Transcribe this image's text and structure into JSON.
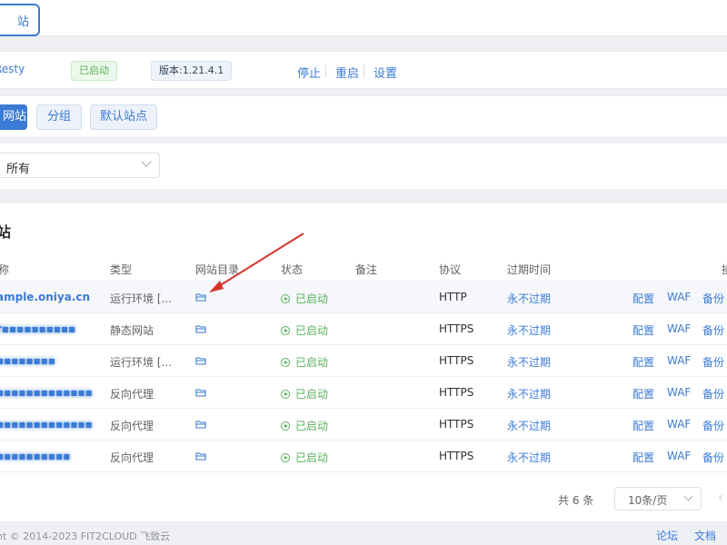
{
  "top_tab": {
    "label": "站"
  },
  "status_bar": {
    "app_name": "Resty",
    "running_tag": "已启动",
    "version_tag": "版本:1.21.4.1",
    "actions": [
      "停止",
      "重启",
      "设置"
    ]
  },
  "toolbar": {
    "primary_label": "网站",
    "group_label": "分组",
    "default_site_label": "默认站点"
  },
  "filter": {
    "selected": "所有"
  },
  "table": {
    "title": "站",
    "headers": [
      "称",
      "类型",
      "网站目录",
      "状态",
      "备注",
      "协议",
      "过期时间",
      "操"
    ],
    "rows": [
      {
        "site": "ample.oniya.cn",
        "type": "运行环境 [...",
        "status": "已启动",
        "protocol": "HTTP",
        "expiry": "永不过期",
        "ops": [
          "配置",
          "WAF",
          "备份"
        ]
      },
      {
        "site": "r▪▪▪▪▪▪▪▪▪▪",
        "type": "静态网站",
        "status": "已启动",
        "protocol": "HTTPS",
        "expiry": "永不过期",
        "ops": [
          "配置",
          "WAF",
          "备份"
        ]
      },
      {
        "site": "▪▪▪▪▪▪▪▪",
        "type": "运行环境 [...",
        "status": "已启动",
        "protocol": "HTTPS",
        "expiry": "永不过期",
        "ops": [
          "配置",
          "WAF",
          "备份"
        ]
      },
      {
        "site": "▪▪▪▪▪▪▪▪▪▪▪▪▪",
        "type": "反向代理",
        "status": "已启动",
        "protocol": "HTTPS",
        "expiry": "永不过期",
        "ops": [
          "配置",
          "WAF",
          "备份"
        ]
      },
      {
        "site": "▪▪▪▪▪▪▪▪▪▪▪▪▪",
        "type": "反向代理",
        "status": "已启动",
        "protocol": "HTTPS",
        "expiry": "永不过期",
        "ops": [
          "配置",
          "WAF",
          "备份"
        ]
      },
      {
        "site": "▪▪▪▪▪▪▪▪▪▪",
        "type": "反向代理",
        "status": "已启动",
        "protocol": "HTTPS",
        "expiry": "永不过期",
        "ops": [
          "配置",
          "WAF",
          "备份"
        ]
      }
    ]
  },
  "pagination": {
    "total": "共 6 条",
    "page_size": "10条/页"
  },
  "footer": {
    "copyright": "nt © 2014-2023 FIT2CLOUD 飞致云",
    "links": [
      "论坛",
      "文档"
    ]
  },
  "colors": {
    "accent": "#3a7bd5",
    "success": "#5ab25a",
    "annotation": "#d9342b"
  },
  "icons": {
    "folder": "folder-icon",
    "status": "play-circle-icon",
    "chevron": "chevron-down-icon"
  }
}
